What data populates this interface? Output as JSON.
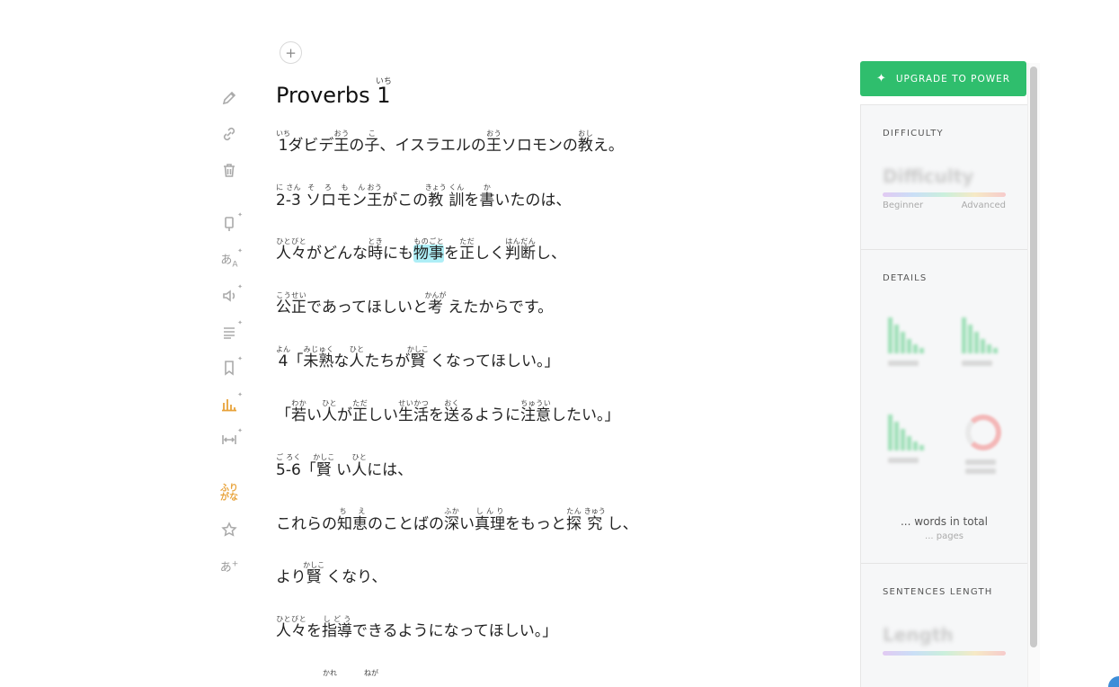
{
  "document": {
    "title": {
      "text": "Proverbs ",
      "num": "1",
      "num_reading": "いち"
    },
    "lines": [
      [
        [
          "1",
          "いち"
        ],
        [
          "ダビデ",
          ""
        ],
        [
          "王",
          "おう"
        ],
        [
          "の",
          ""
        ],
        [
          "子",
          "こ"
        ],
        [
          "、イスラエルの",
          ""
        ],
        [
          "王",
          "おう"
        ],
        [
          "ソロモンの",
          ""
        ],
        [
          "教",
          "おし"
        ],
        [
          "え。",
          ""
        ]
      ],
      [
        [
          "2-3",
          "に さん"
        ],
        [
          " ",
          ""
        ],
        [
          "ソロモン",
          "そ ろ も ん"
        ],
        [
          "王",
          "おう"
        ],
        [
          "がこの",
          ""
        ],
        [
          "教",
          "きょう"
        ],
        [
          " ",
          ""
        ],
        [
          "訓",
          "くん"
        ],
        [
          "を",
          ""
        ],
        [
          "書",
          "か"
        ],
        [
          "いたのは、",
          ""
        ]
      ],
      [
        [
          "人々",
          "ひとびと"
        ],
        [
          "がどんな",
          ""
        ],
        [
          "時",
          "とき"
        ],
        [
          "にも",
          ""
        ],
        [
          "物事",
          "ものごと",
          "hl"
        ],
        [
          "を",
          ""
        ],
        [
          "正",
          "ただ"
        ],
        [
          "しく",
          ""
        ],
        [
          "判断",
          "はんだん"
        ],
        [
          "し、",
          ""
        ]
      ],
      [
        [
          "公正",
          "こうせい"
        ],
        [
          "であってほしいと",
          ""
        ],
        [
          "考",
          "かんが"
        ],
        [
          " えたからです。",
          ""
        ]
      ],
      [
        [
          "4",
          "よん"
        ],
        [
          "「",
          ""
        ],
        [
          "未熟",
          "みじゅく"
        ],
        [
          "な",
          ""
        ],
        [
          "人",
          "ひと"
        ],
        [
          "たちが",
          ""
        ],
        [
          "賢",
          "かしこ"
        ],
        [
          " くなってほしい。」",
          ""
        ]
      ],
      [
        [
          "「",
          ""
        ],
        [
          "若",
          "わか"
        ],
        [
          "い",
          ""
        ],
        [
          "人",
          "ひと"
        ],
        [
          "が",
          ""
        ],
        [
          "正",
          "ただ"
        ],
        [
          "しい",
          ""
        ],
        [
          "生活",
          "せいかつ"
        ],
        [
          "を",
          ""
        ],
        [
          "送",
          "おく"
        ],
        [
          "るように",
          ""
        ],
        [
          "注意",
          "ちゅうい"
        ],
        [
          "したい。」",
          ""
        ]
      ],
      [
        [
          "5-6",
          "ご ろく"
        ],
        [
          "「",
          ""
        ],
        [
          "賢",
          "かしこ"
        ],
        [
          " い",
          ""
        ],
        [
          "人",
          "ひと"
        ],
        [
          "には、",
          ""
        ]
      ],
      [
        [
          "これらの",
          ""
        ],
        [
          "知恵",
          "ち え"
        ],
        [
          "のことばの",
          ""
        ],
        [
          "深",
          "ふか"
        ],
        [
          "い",
          ""
        ],
        [
          "真理",
          "しんり"
        ],
        [
          "をもっと",
          ""
        ],
        [
          "探",
          "たん"
        ],
        [
          " ",
          ""
        ],
        [
          "究",
          "きゅう"
        ],
        [
          " し、",
          ""
        ]
      ],
      [
        [
          "より",
          ""
        ],
        [
          "賢",
          "かしこ"
        ],
        [
          " くなり、",
          ""
        ]
      ],
      [
        [
          "人々",
          "ひとびと"
        ],
        [
          "を",
          ""
        ],
        [
          "指導",
          "しどう"
        ],
        [
          "できるようになってほしい。」",
          ""
        ]
      ]
    ],
    "partial_readings": [
      "かれ",
      "ねが"
    ]
  },
  "sidebar": {
    "upgrade_label": "UPGRADE TO POWER",
    "difficulty": {
      "title": "DIFFICULTY",
      "blurred_label": "Difficulty",
      "low": "Beginner",
      "high": "Advanced"
    },
    "details": {
      "title": "DETAILS",
      "words_total": "... words in total",
      "pages": "... pages"
    },
    "sentences": {
      "title": "SENTENCES LENGTH",
      "blurred_label": "Length"
    }
  },
  "colors": {
    "accent_green": "#2fbe6d",
    "highlight": "#aeeef6",
    "furigana_toggle": "#e8a33b",
    "stats_active": "#e8a33b"
  }
}
